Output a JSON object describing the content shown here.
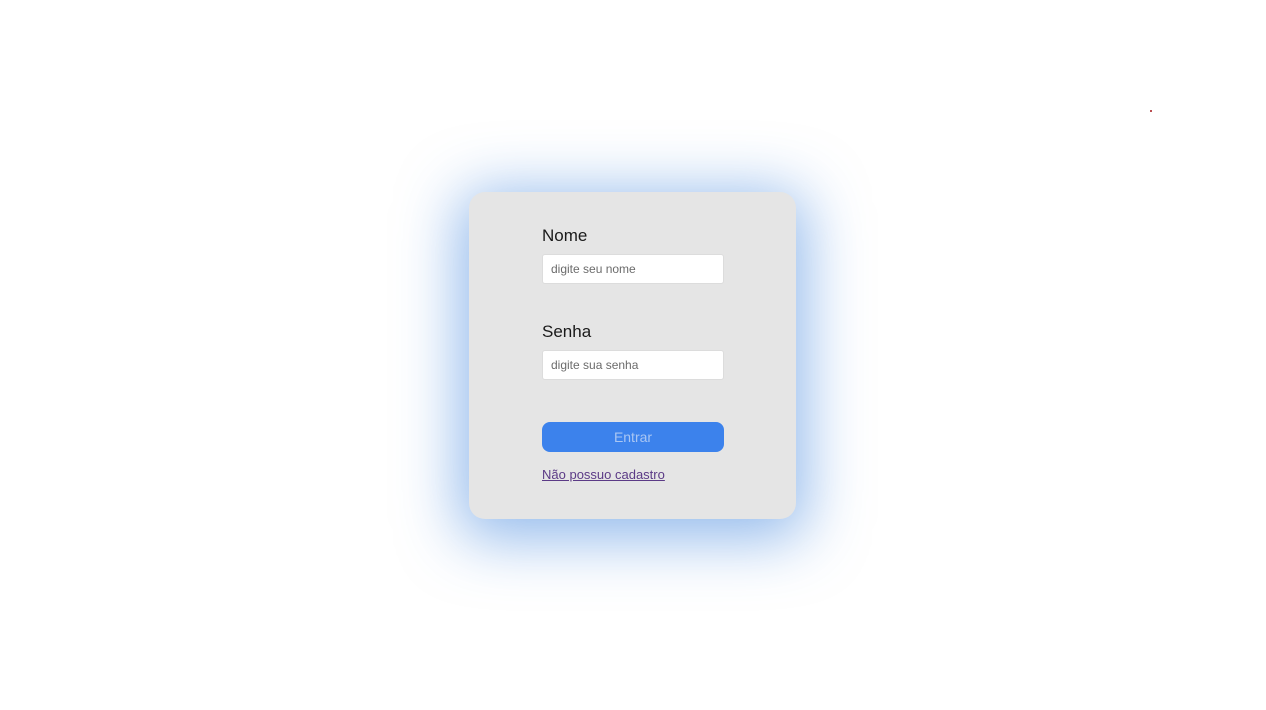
{
  "login_form": {
    "name_label": "Nome",
    "name_placeholder": "digite seu nome",
    "name_value": "",
    "password_label": "Senha",
    "password_placeholder": "digite sua senha",
    "password_value": "",
    "submit_label": "Entrar",
    "signup_link": "Não possuo cadastro"
  },
  "colors": {
    "background": "#ffffff",
    "card": "#e5e5e5",
    "glow": "#3a82dd",
    "button": "#3c82ec",
    "button_text": "#a9c6f3",
    "link": "#5b3a86"
  }
}
